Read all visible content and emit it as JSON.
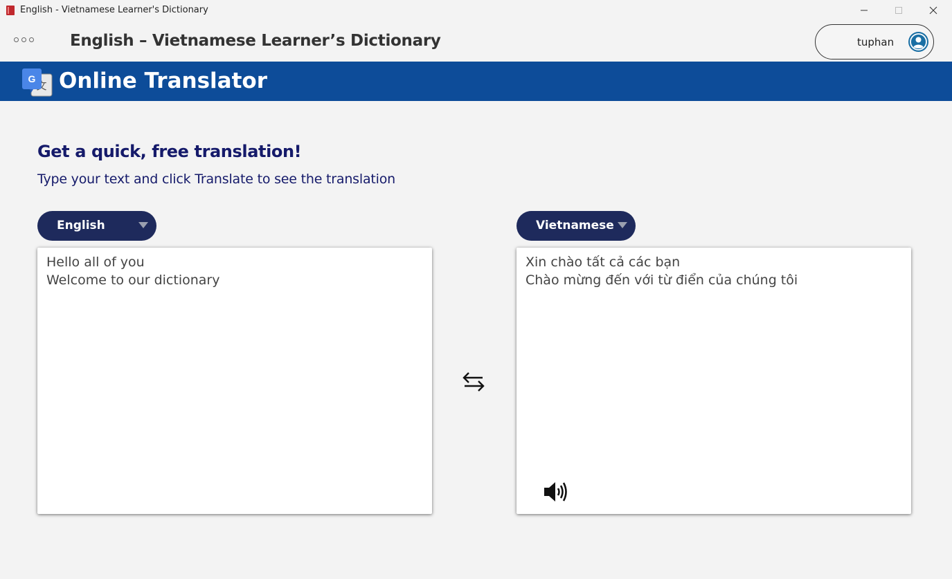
{
  "window": {
    "title": "English - Vietnamese Learner's Dictionary"
  },
  "header": {
    "app_title": "English – Vietnamese Learner’s Dictionary",
    "username": "tuphan"
  },
  "banner": {
    "title": "Online Translator",
    "color": "#0d4c99"
  },
  "main": {
    "headline": "Get a quick, free translation!",
    "subline": "Type your text and click Translate to see the translation",
    "source": {
      "language": "English",
      "text": "Hello all of you\nWelcome to our dictionary"
    },
    "target": {
      "language": "Vietnamese",
      "text": "Xin chào tất cả các bạn\nChào mừng đến với từ điển của chúng tôi"
    }
  },
  "icons": {
    "menu": "more-dots-icon",
    "avatar": "user-avatar-icon",
    "translate": "google-translate-icon",
    "swap": "swap-arrows-icon",
    "speaker": "speaker-icon"
  },
  "colors": {
    "accent_dark": "#1e2a5c",
    "heading_text": "#151a6a"
  }
}
